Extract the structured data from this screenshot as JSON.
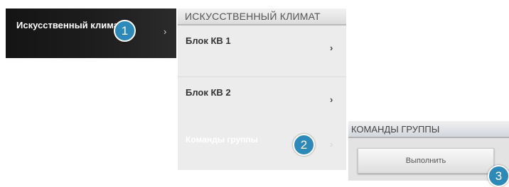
{
  "main_menu": {
    "item_label": "Искусственный климат",
    "chevron": "›"
  },
  "climate_panel": {
    "title": "ИСКУССТВЕННЫЙ КЛИМАТ",
    "items": [
      {
        "label": "Блок КВ 1",
        "chevron": "›"
      },
      {
        "label": "Блок КВ 2",
        "chevron": "›"
      },
      {
        "label": "Команды группы",
        "chevron": "›"
      }
    ]
  },
  "group_panel": {
    "title": "КОМАНДЫ ГРУППЫ",
    "execute_label": "Выполнить"
  },
  "badges": [
    "1",
    "2",
    "3"
  ],
  "colors": {
    "badge": "#2d8ab8",
    "dark_item": "#1a1a1a",
    "panel_bg": "#ececec"
  }
}
